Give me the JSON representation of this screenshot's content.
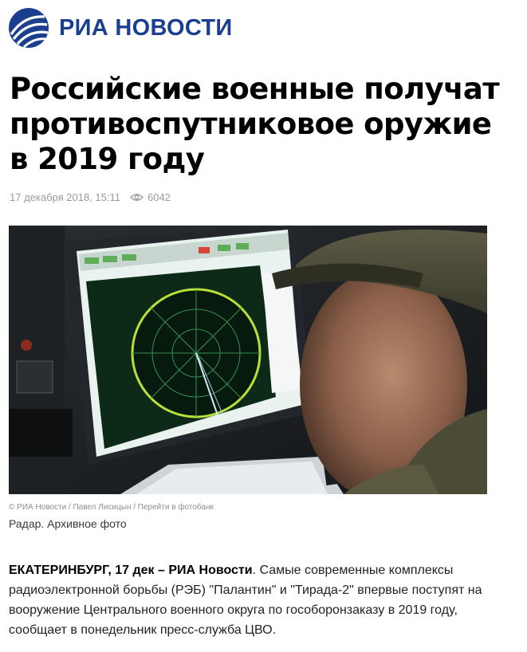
{
  "header": {
    "logo_icon": "ria-globe-logo",
    "site_name": "РИА НОВОСТИ",
    "brand_color": "#1b3f8f"
  },
  "article": {
    "title": "Российские военные получат противоспутниковое оружие в 2019 году",
    "date": "17 декабря 2018, 15:11",
    "views_icon": "eye-icon",
    "views": "6042",
    "photo": {
      "credit": "© РИА Новости / Павел Лисицын / Перейти в фотобанк",
      "caption": "Радар. Архивное фото"
    },
    "lead": {
      "dateline": "ЕКАТЕРИНБУРГ, 17 дек – РИА Новости",
      "text": ". Самые современные комплексы радиоэлектронной борьбы (РЭБ) \"Палантин\" и \"Тирада-2\" впервые поступят на вооружение Центрального военного округа по гособоронзаказу в 2019 году, сообщает в понедельник пресс-служба ЦВО."
    }
  }
}
